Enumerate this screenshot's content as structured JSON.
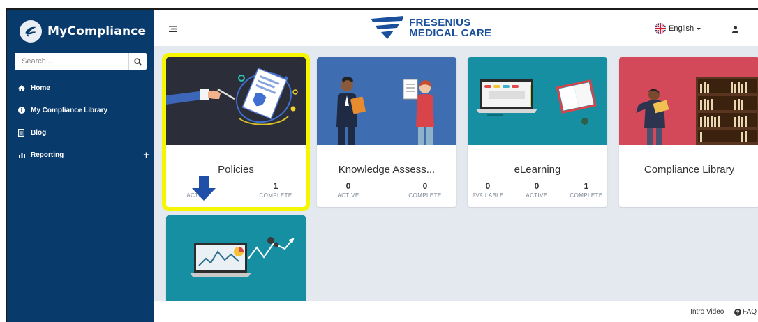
{
  "sidebar": {
    "brand": "MyCompliance",
    "search": {
      "placeholder": "Search..."
    },
    "items": [
      {
        "label": "Home",
        "icon": "home-icon"
      },
      {
        "label": "My Compliance Library",
        "icon": "info-icon"
      },
      {
        "label": "Blog",
        "icon": "document-icon"
      },
      {
        "label": "Reporting",
        "icon": "bar-chart-icon",
        "expand": "+"
      }
    ]
  },
  "header": {
    "logo_line1": "FRESENIUS",
    "logo_line2": "MEDICAL CARE",
    "language": "English",
    "language_icon": "uk-flag-icon",
    "user_icon": "user-icon"
  },
  "cards": [
    {
      "title": "Policies",
      "stats": [
        {
          "value": "",
          "label": "ACTIVE"
        },
        {
          "value": "1",
          "label": "COMPLETE"
        }
      ],
      "highlighted": true
    },
    {
      "title": "Knowledge Assess...",
      "stats": [
        {
          "value": "0",
          "label": "ACTIVE"
        },
        {
          "value": "0",
          "label": "COMPLETE"
        }
      ]
    },
    {
      "title": "eLearning",
      "stats": [
        {
          "value": "0",
          "label": "AVAILABLE"
        },
        {
          "value": "0",
          "label": "ACTIVE"
        },
        {
          "value": "1",
          "label": "COMPLETE"
        }
      ]
    },
    {
      "title": "Compliance Library",
      "stats": []
    },
    {
      "title": "",
      "stats": []
    }
  ],
  "footer": {
    "intro_video": "Intro Video",
    "faq": "FAQ"
  },
  "colors": {
    "sidebar": "#083a6c",
    "highlight": "#f6f600",
    "brand_blue": "#1a4f9c",
    "card_blue": "#3f6db1",
    "card_teal": "#168fa3",
    "card_red": "#d4495a"
  }
}
